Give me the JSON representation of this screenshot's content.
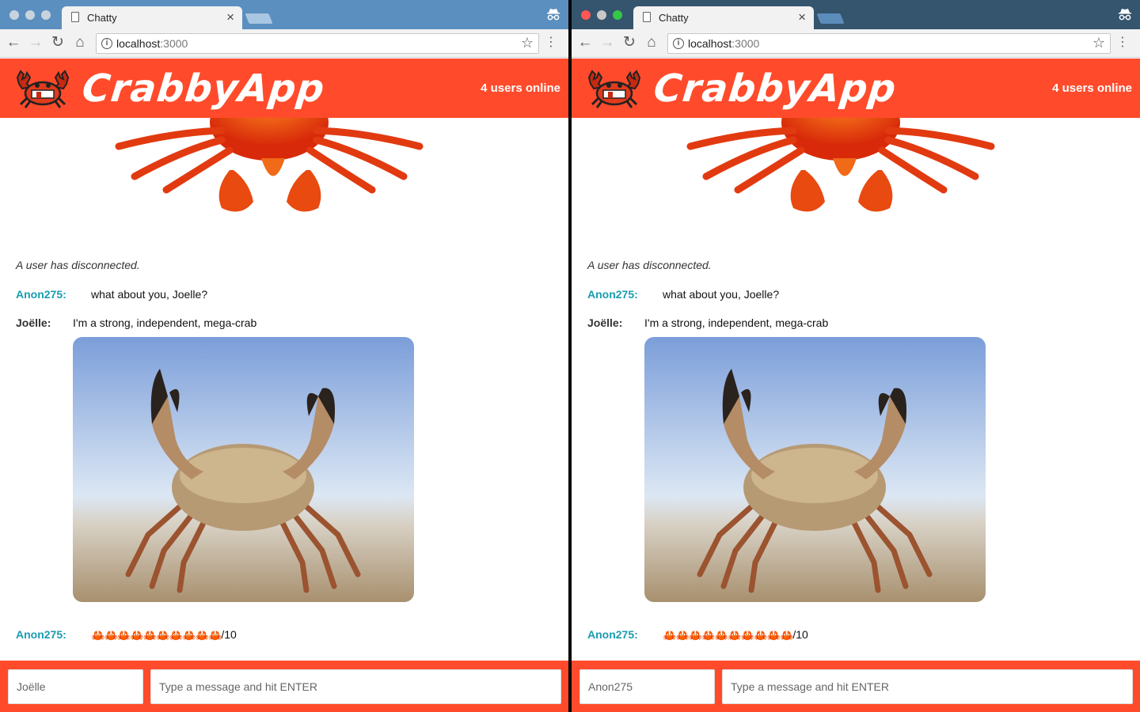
{
  "windows": [
    {
      "tab_title": "Chatty",
      "url_host": "localhost",
      "url_port": ":3000",
      "app_title": "CrabbyApp",
      "users_online": "4 users online",
      "system_message": "A user has disconnected.",
      "messages": [
        {
          "username": "Anon275:",
          "content": "what about you, Joelle?"
        },
        {
          "username": "Joëlle:",
          "content": "I'm a strong, independent, mega-crab"
        },
        {
          "username": "Anon275:",
          "content": "/10"
        }
      ],
      "name_field": {
        "placeholder": "Joëlle"
      },
      "message_field": {
        "placeholder": "Type a message and hit ENTER"
      }
    },
    {
      "tab_title": "Chatty",
      "url_host": "localhost",
      "url_port": ":3000",
      "app_title": "CrabbyApp",
      "users_online": "4 users online",
      "system_message": "A user has disconnected.",
      "messages": [
        {
          "username": "Anon275:",
          "content": "what about you, Joelle?"
        },
        {
          "username": "Joëlle:",
          "content": "I'm a strong, independent, mega-crab"
        },
        {
          "username": "Anon275:",
          "content": "/10"
        }
      ],
      "name_field": {
        "placeholder": "Anon275"
      },
      "message_field": {
        "placeholder": "Type a message and hit ENTER"
      }
    }
  ],
  "icons": {
    "crab_emoji_count": 10,
    "logo": "crab-logo-icon",
    "incognito": "incognito-icon"
  },
  "colors": {
    "brand": "#ff4b2b",
    "username_anon": "#1a9cb0",
    "username_joelle": "#333333",
    "tabstrip_left": "#5b8fbf",
    "tabstrip_right": "#35546e"
  }
}
